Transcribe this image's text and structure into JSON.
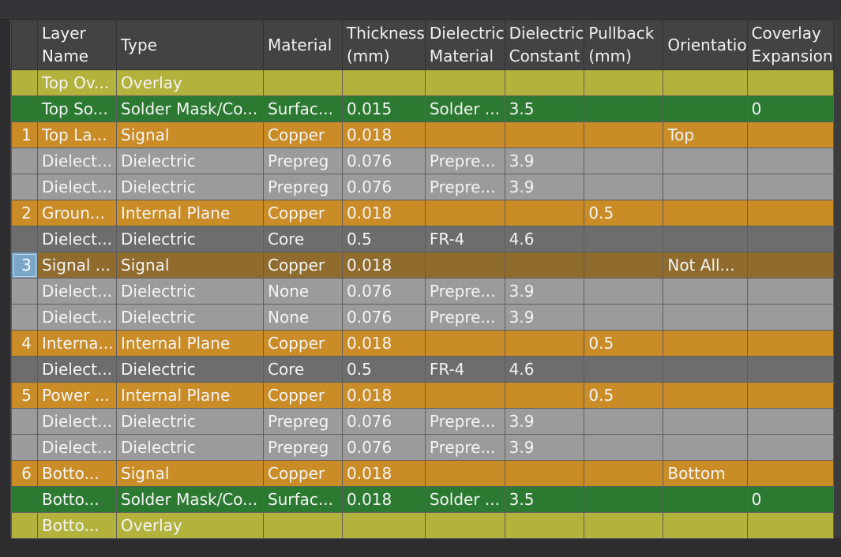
{
  "colors": {
    "overlay": "#b3b23d",
    "solder_mask": "#2c7a32",
    "copper": "#c98c26",
    "dielectric_prepreg": "#9b9b9b",
    "dielectric_core": "#6d6d6d",
    "selected_row": "#8f6b2e",
    "active_row_number": "#7aa6c8"
  },
  "headers": [
    {
      "key": "rownum",
      "lines": [
        ""
      ]
    },
    {
      "key": "layer_name",
      "lines": [
        "Layer",
        "Name"
      ]
    },
    {
      "key": "type",
      "lines": [
        "Type"
      ]
    },
    {
      "key": "material",
      "lines": [
        "Material"
      ]
    },
    {
      "key": "thickness",
      "lines": [
        "Thickness",
        "(mm)"
      ]
    },
    {
      "key": "dielectric_material",
      "lines": [
        "Dielectric",
        "Material"
      ]
    },
    {
      "key": "dielectric_constant",
      "lines": [
        "Dielectric",
        "Constant"
      ]
    },
    {
      "key": "pullback",
      "lines": [
        "Pullback",
        "(mm)"
      ]
    },
    {
      "key": "orientation",
      "lines": [
        "Orientatio"
      ]
    },
    {
      "key": "coverlay_expansion",
      "lines": [
        "Coverlay",
        "Expansion"
      ]
    }
  ],
  "rows": [
    {
      "kind": "overlay",
      "num": "",
      "cells": [
        "Top Ov...",
        "Overlay",
        "",
        "",
        "",
        "",
        "",
        "",
        ""
      ]
    },
    {
      "kind": "solder_mask",
      "num": "",
      "cells": [
        "Top So...",
        "Solder Mask/Co...",
        "Surfac...",
        "0.015",
        "Solder ...",
        "3.5",
        "",
        "",
        "0"
      ]
    },
    {
      "kind": "copper",
      "num": "1",
      "cells": [
        "Top La...",
        "Signal",
        "Copper",
        "0.018",
        "",
        "",
        "",
        "Top",
        ""
      ]
    },
    {
      "kind": "dielectric_prepreg",
      "num": "",
      "cells": [
        "Dielect...",
        "Dielectric",
        "Prepreg",
        "0.076",
        "Prepre...",
        "3.9",
        "",
        "",
        ""
      ]
    },
    {
      "kind": "dielectric_prepreg",
      "num": "",
      "cells": [
        "Dielect...",
        "Dielectric",
        "Prepreg",
        "0.076",
        "Prepre...",
        "3.9",
        "",
        "",
        ""
      ]
    },
    {
      "kind": "copper",
      "num": "2",
      "cells": [
        "Groun...",
        "Internal Plane",
        "Copper",
        "0.018",
        "",
        "",
        "0.5",
        "",
        ""
      ]
    },
    {
      "kind": "dielectric_core",
      "num": "",
      "cells": [
        "Dielect...",
        "Dielectric",
        "Core",
        "0.5",
        "FR-4",
        "4.6",
        "",
        "",
        ""
      ]
    },
    {
      "kind": "selected_row",
      "num": "3",
      "active": true,
      "cells": [
        "Signal ...",
        "Signal",
        "Copper",
        "0.018",
        "",
        "",
        "",
        "Not All...",
        ""
      ]
    },
    {
      "kind": "dielectric_prepreg",
      "num": "",
      "cells": [
        "Dielect...",
        "Dielectric",
        "None",
        "0.076",
        "Prepre...",
        "3.9",
        "",
        "",
        ""
      ]
    },
    {
      "kind": "dielectric_prepreg",
      "num": "",
      "cells": [
        "Dielect...",
        "Dielectric",
        "None",
        "0.076",
        "Prepre...",
        "3.9",
        "",
        "",
        ""
      ]
    },
    {
      "kind": "copper",
      "num": "4",
      "cells": [
        "Interna...",
        "Internal Plane",
        "Copper",
        "0.018",
        "",
        "",
        "0.5",
        "",
        ""
      ]
    },
    {
      "kind": "dielectric_core",
      "num": "",
      "cells": [
        "Dielect...",
        "Dielectric",
        "Core",
        "0.5",
        "FR-4",
        "4.6",
        "",
        "",
        ""
      ]
    },
    {
      "kind": "copper",
      "num": "5",
      "cells": [
        "Power ...",
        "Internal Plane",
        "Copper",
        "0.018",
        "",
        "",
        "0.5",
        "",
        ""
      ]
    },
    {
      "kind": "dielectric_prepreg",
      "num": "",
      "cells": [
        "Dielect...",
        "Dielectric",
        "Prepreg",
        "0.076",
        "Prepre...",
        "3.9",
        "",
        "",
        ""
      ]
    },
    {
      "kind": "dielectric_prepreg",
      "num": "",
      "cells": [
        "Dielect...",
        "Dielectric",
        "Prepreg",
        "0.076",
        "Prepre...",
        "3.9",
        "",
        "",
        ""
      ]
    },
    {
      "kind": "copper",
      "num": "6",
      "cells": [
        "Botto...",
        "Signal",
        "Copper",
        "0.018",
        "",
        "",
        "",
        "Bottom",
        ""
      ]
    },
    {
      "kind": "solder_mask",
      "num": "",
      "cells": [
        "Botto...",
        "Solder Mask/Co...",
        "Surfac...",
        "0.018",
        "Solder ...",
        "3.5",
        "",
        "",
        "0"
      ]
    },
    {
      "kind": "overlay",
      "num": "",
      "cells": [
        "Botto...",
        "Overlay",
        "",
        "",
        "",
        "",
        "",
        "",
        ""
      ]
    }
  ]
}
